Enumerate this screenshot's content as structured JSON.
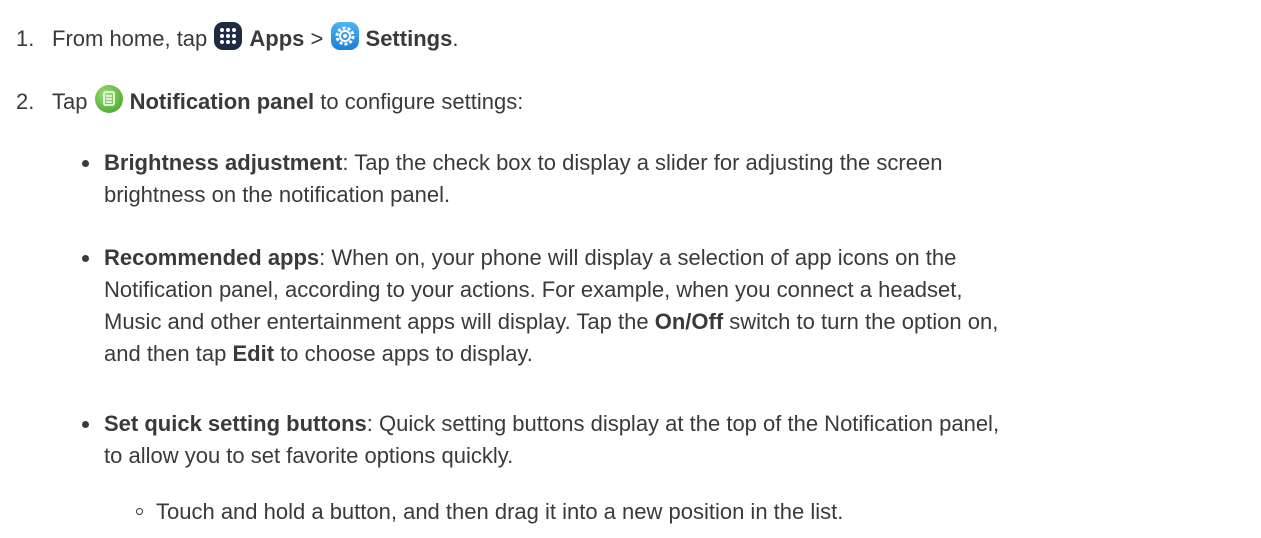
{
  "step1": {
    "number": "1.",
    "prefix": "From home, tap",
    "apps_label": "Apps",
    "separator": ">",
    "settings_label": "Settings",
    "suffix": "."
  },
  "step2": {
    "number": "2.",
    "prefix": "Tap",
    "panel_label": "Notification panel",
    "suffix": "to configure settings:"
  },
  "bullets": [
    {
      "term": "Brightness adjustment",
      "line1": ": Tap the check box to display a slider for adjusting the screen",
      "line2": "brightness on the notification panel."
    },
    {
      "term": "Recommended apps",
      "line1": ": When on, your phone will display a selection of app icons on the",
      "line2": "Notification panel, according to your actions. For example, when you connect a headset,",
      "line3a": "Music and other entertainment apps will display. Tap the",
      "onoff": "On/Off",
      "line3b": "switch to turn the option on,",
      "line4a": "and then tap",
      "edit": "Edit",
      "line4b": "to choose apps to display."
    },
    {
      "term": "Set quick setting buttons",
      "line1": ": Quick setting buttons display at the top of the Notification panel,",
      "line2": "to allow you to set favorite options quickly."
    }
  ],
  "subbullet": {
    "text": "Touch and hold a button, and then drag it into a new position in the list."
  },
  "icons": {
    "apps": "apps-grid-icon",
    "settings": "settings-gear-icon",
    "notification": "notification-panel-icon"
  },
  "colors": {
    "text": "#3a3a3a",
    "apps_icon": "#1f2a44",
    "settings_icon": "#2a8fe0",
    "notification_icon": "#6cc24a"
  }
}
